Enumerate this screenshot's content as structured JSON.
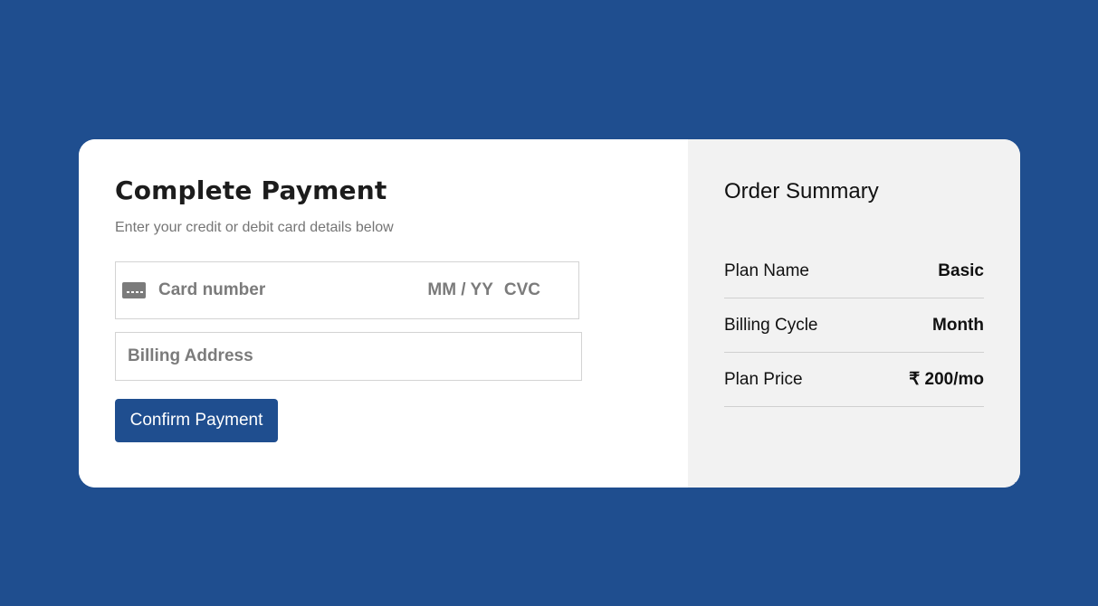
{
  "payment": {
    "title": "Complete Payment",
    "subtitle": "Enter your credit or debit card details below",
    "card_number_placeholder": "Card number",
    "expiry_placeholder": "MM / YY",
    "cvc_placeholder": "CVC",
    "billing_address_placeholder": "Billing Address",
    "confirm_label": "Confirm Payment",
    "card_icon": "credit-card-icon"
  },
  "summary": {
    "title": "Order Summary",
    "rows": [
      {
        "label": "Plan Name",
        "value": "Basic"
      },
      {
        "label": "Billing Cycle",
        "value": "Month"
      },
      {
        "label": "Plan Price",
        "value": "₹ 200/mo"
      }
    ]
  },
  "colors": {
    "background": "#1f4e8f",
    "button": "#1f4e8f",
    "summary_panel": "#f2f2f2"
  }
}
